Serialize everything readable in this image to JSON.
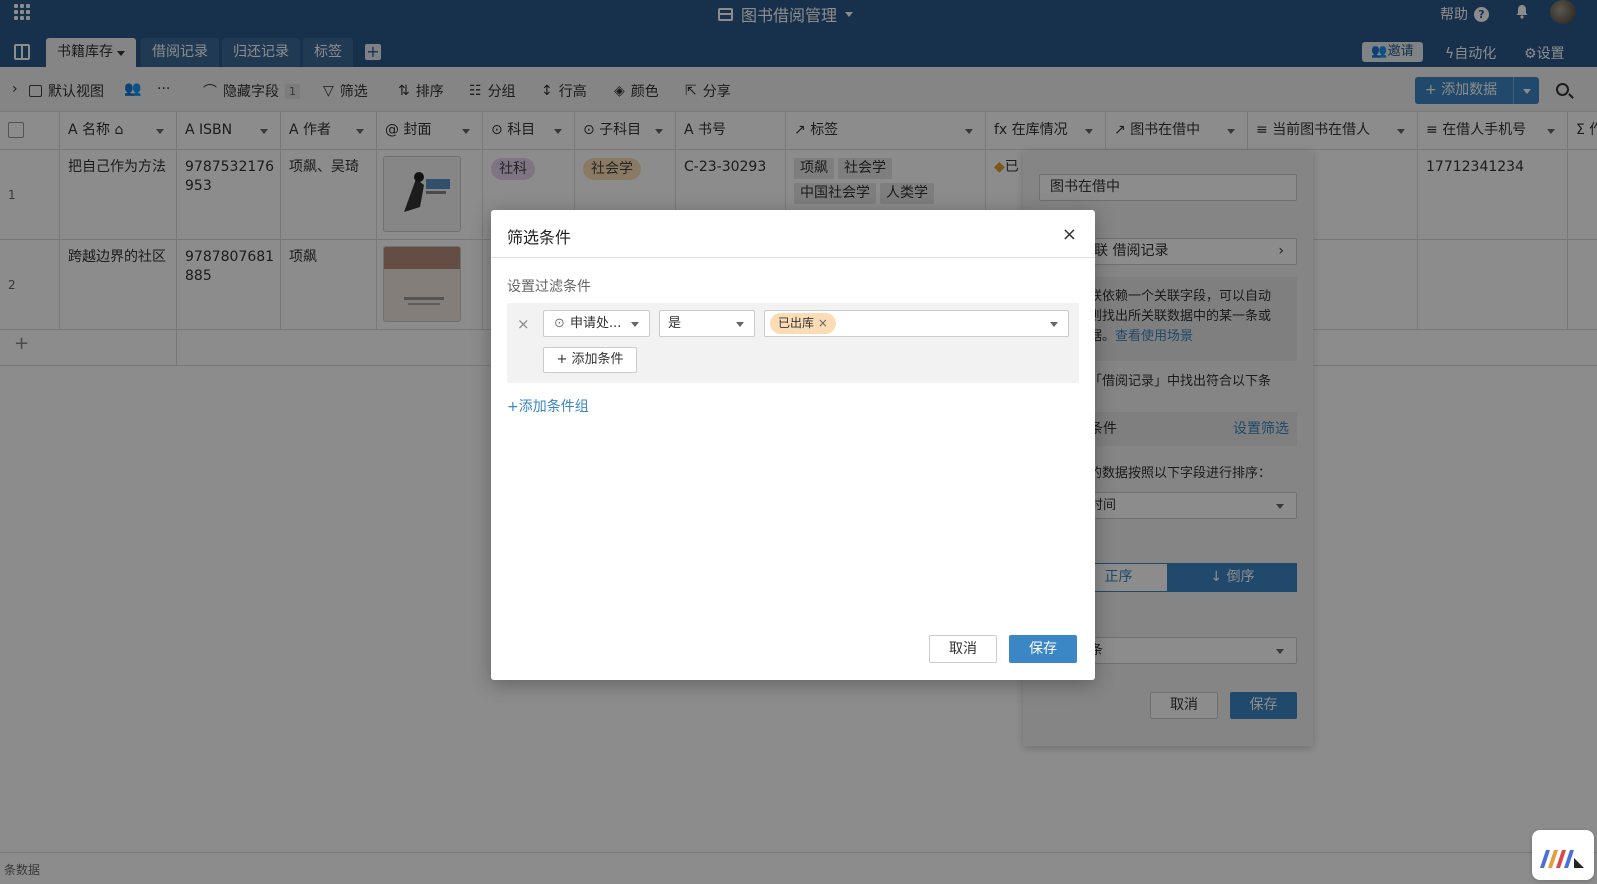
{
  "app": {
    "title": "图书借阅管理",
    "help": "帮助"
  },
  "tabs": [
    "书籍库存",
    "借阅记录",
    "归还记录",
    "标签"
  ],
  "header_right": {
    "invite": "邀请",
    "automation": "自动化",
    "settings": "设置"
  },
  "toolbar": {
    "view": "默认视图",
    "hide_fields": "隐藏字段",
    "hide_count": "1",
    "filter": "筛选",
    "sort": "排序",
    "group": "分组",
    "row_height": "行高",
    "color": "颜色",
    "share": "分享",
    "add_record": "添加数据"
  },
  "columns": [
    "名称",
    "ISBN",
    "作者",
    "封面",
    "科目",
    "子科目",
    "书号",
    "标签",
    "在库情况",
    "图书在借中",
    "当前图书在借人",
    "在借人手机号",
    "作"
  ],
  "rows": [
    {
      "num": "1",
      "name": "把自己作为方法",
      "isbn1": "9787532176",
      "isbn2": "953",
      "author": "项飙、吴琦",
      "subject": "社科",
      "subsubject": "社会学",
      "code": "C-23-30293",
      "tags": [
        "项飙",
        "社会学",
        "中国社会学",
        "人类学"
      ],
      "instock": "已",
      "phone": "17712341234"
    },
    {
      "num": "2",
      "name": "跨越边界的社区",
      "isbn1": "9787807681",
      "isbn2": "885",
      "author": "项飙"
    }
  ],
  "add_row": "+",
  "footer": {
    "count": "条数据"
  },
  "panel": {
    "field_value": "图书在借中",
    "link": "关联 借阅记录",
    "desc1": "联依赖一个关联字段，可以自动",
    "desc2": "则找出所关联数据中的某一条或",
    "desc3": "据。",
    "desc_link": "查看使用场景",
    "from": "「借阅记录」中找出符合以下条",
    "from2": "：",
    "cond": "条件",
    "set_filter": "设置筛选",
    "sort_label": "的数据按照以下字段进行排序：",
    "sort_field": "时间",
    "order_label": "：",
    "asc": "正序",
    "desc": "倒序",
    "bottom_sel": "条",
    "cancel": "取消",
    "save": "保存"
  },
  "modal": {
    "title": "筛选条件",
    "sublabel": "设置过滤条件",
    "field": "申请处...",
    "operator": "是",
    "value_tag": "已出库",
    "add_condition": "添加条件",
    "add_group": "添加条件组",
    "cancel": "取消",
    "save": "保存"
  }
}
